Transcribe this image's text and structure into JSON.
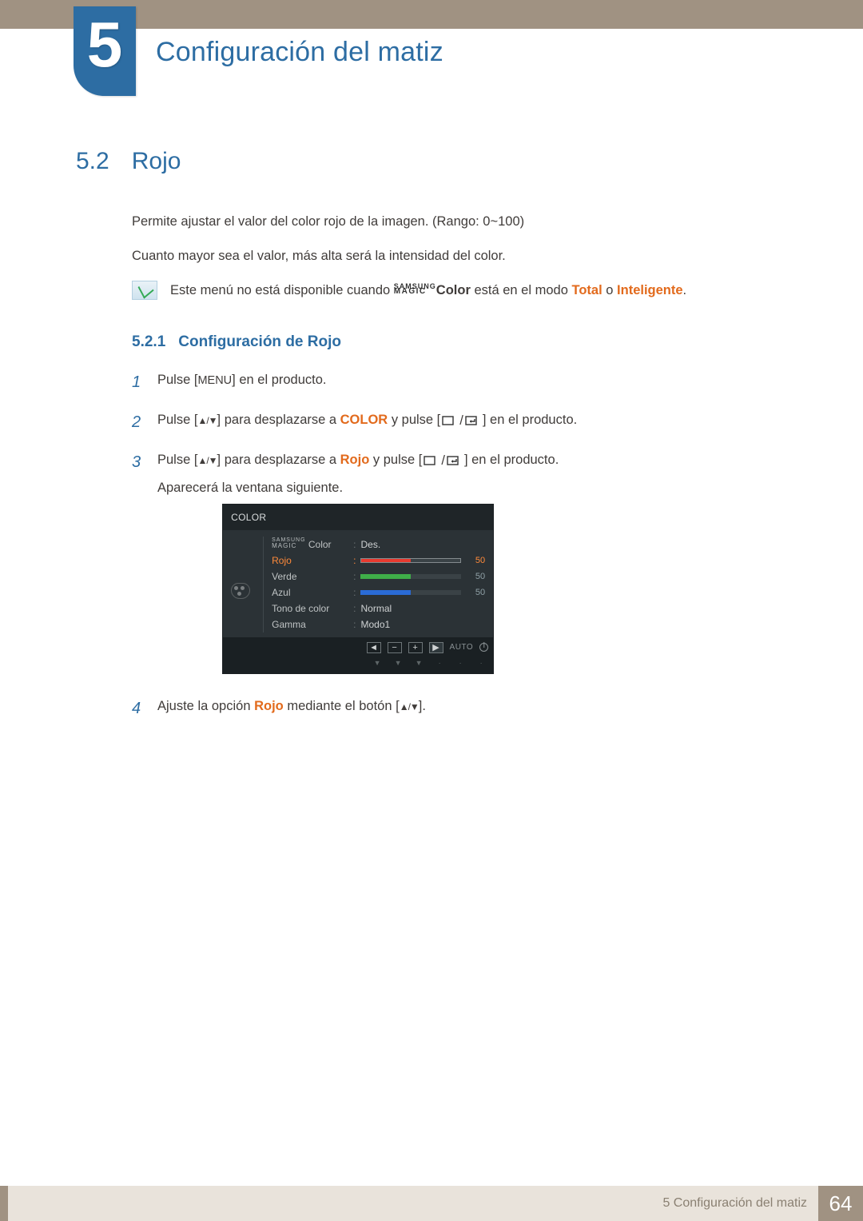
{
  "chapter": {
    "number": "5",
    "title": "Configuración del matiz"
  },
  "section": {
    "number": "5.2",
    "title": "Rojo"
  },
  "intro": {
    "p1": "Permite ajustar el valor del color rojo de la imagen. (Rango: 0~100)",
    "p2": "Cuanto mayor sea el valor, más alta será la intensidad del color."
  },
  "note": {
    "pre": "Este menú no está disponible cuando ",
    "magic_top": "SAMSUNG",
    "magic_bottom": "MAGIC",
    "color_word": "Color",
    "mid": " está en el modo ",
    "mode1": "Total",
    "or": " o ",
    "mode2": "Inteligente",
    "end": "."
  },
  "subsection": {
    "number": "5.2.1",
    "title": "Configuración de Rojo"
  },
  "steps": {
    "s1": {
      "n": "1",
      "a": "Pulse [",
      "menu": "MENU",
      "b": "] en el producto."
    },
    "s2": {
      "n": "2",
      "a": "Pulse [",
      "arrows": "▲/▼",
      "b": "] para desplazarse a ",
      "target": "COLOR",
      "c": " y pulse [",
      "d": "] en el producto."
    },
    "s3": {
      "n": "3",
      "a": "Pulse [",
      "arrows": "▲/▼",
      "b": "] para desplazarse a ",
      "target": "Rojo",
      "c": " y pulse [",
      "d": "] en el producto.",
      "follow": "Aparecerá la ventana siguiente."
    },
    "s4": {
      "n": "4",
      "a": "Ajuste la opción ",
      "target": "Rojo",
      "b": " mediante el botón [",
      "arrows": "▲/▼",
      "c": "]."
    }
  },
  "osd": {
    "title": "COLOR",
    "magic_top": "SAMSUNG",
    "magic_bottom": "MAGIC",
    "magic_label": " Color",
    "magic_val": "Des.",
    "rows": {
      "rojo": {
        "label": "Rojo",
        "value": "50"
      },
      "verde": {
        "label": "Verde",
        "value": "50"
      },
      "azul": {
        "label": "Azul",
        "value": "50"
      },
      "tono": {
        "label": "Tono de color",
        "value": "Normal"
      },
      "gamma": {
        "label": "Gamma",
        "value": "Modo1"
      }
    },
    "footer": {
      "left": "◄",
      "minus": "−",
      "plus": "+",
      "play": "▶",
      "auto": "AUTO",
      "arrow_hint": "▼"
    }
  },
  "footer": {
    "caption": "5 Configuración del matiz",
    "page": "64"
  },
  "chart_data": {
    "type": "bar",
    "title": "COLOR OSD sliders",
    "categories": [
      "Rojo",
      "Verde",
      "Azul"
    ],
    "values": [
      50,
      50,
      50
    ],
    "ylim": [
      0,
      100
    ],
    "xlabel": "",
    "ylabel": ""
  }
}
